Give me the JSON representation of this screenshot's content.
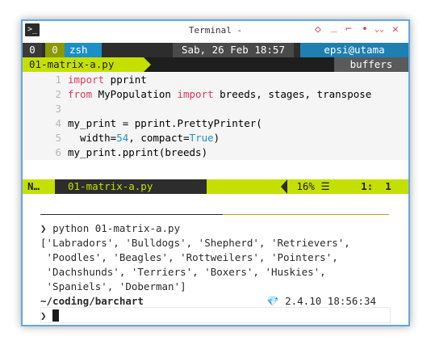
{
  "window": {
    "title": "Terminal -",
    "controls": [
      "◇",
      "_",
      "⌐",
      "•",
      "⌄⌄",
      "✕"
    ]
  },
  "tmux": {
    "index": "0",
    "win_index": "0",
    "session": "zsh",
    "datetime": "Sab, 26 Feb 18:57",
    "user_host": "epsi@utama"
  },
  "buffer_bar": {
    "file": "01-matrix-a.py",
    "right_label": "buffers"
  },
  "code_lines": [
    {
      "num": "1",
      "text": "import pprint"
    },
    {
      "num": "2",
      "text": "from MyPopulation import breeds, stages, transpose"
    },
    {
      "num": "3",
      "text": ""
    },
    {
      "num": "4",
      "text": "my_print = pprint.PrettyPrinter("
    },
    {
      "num": "5",
      "text": "  width=54, compact=True)"
    },
    {
      "num": "6",
      "text": "my_print.pprint(breeds)"
    }
  ],
  "statusline": {
    "mode": "N…",
    "file": "01-matrix-a.py",
    "percent": "16%",
    "position": "1:  1"
  },
  "shell": {
    "prompt_symbol": "❯",
    "command": "python 01-matrix-a.py",
    "output": [
      "['Labradors', 'Bulldogs', 'Shepherd', 'Retrievers',",
      " 'Poodles', 'Beagles', 'Rottweilers', 'Pointers',",
      " 'Dachshunds', 'Terriers', 'Boxers', 'Huskies',",
      " 'Spaniels', 'Doberman']"
    ],
    "cwd": "~/coding/barchart",
    "python_version": "2.4.10",
    "time": "18:56:34"
  },
  "colors": {
    "accent_lime": "#c4e000",
    "tmux_blue": "#1b8fc6",
    "keyword_red": "#d93a59",
    "border_blue": "#64a8dd"
  }
}
